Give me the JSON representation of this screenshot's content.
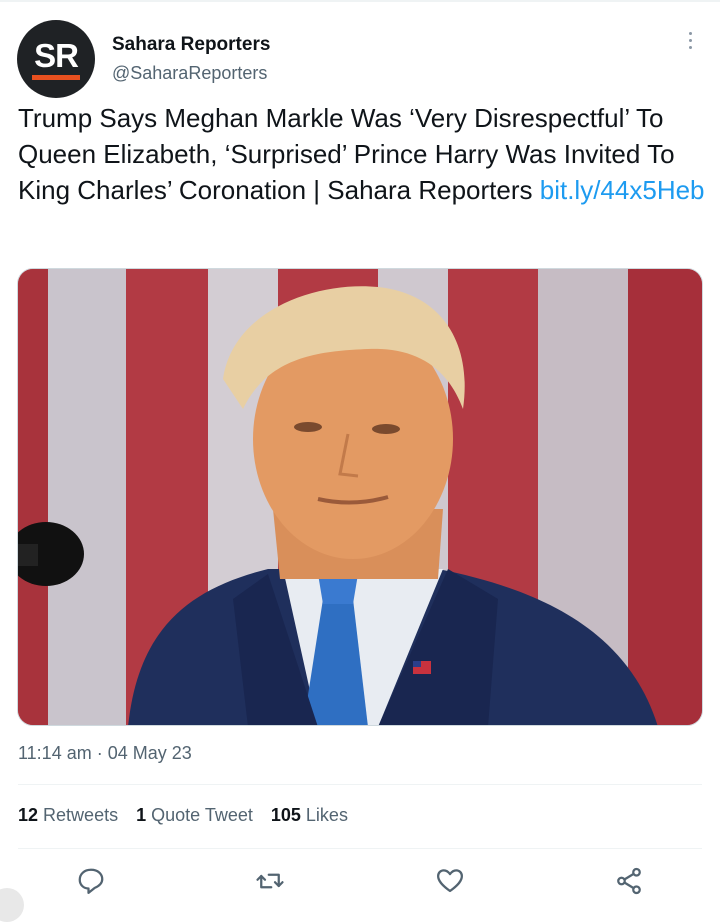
{
  "account": {
    "avatar_text": "SR",
    "name": "Sahara Reporters",
    "handle": "@SaharaReporters"
  },
  "tweet": {
    "text": "Trump Says Meghan Markle Was ‘Very Disrespectful’ To Queen Elizabeth, ‘Surprised’ Prince Harry Was Invited To King Charles’ Coronation | Sahara Reporters",
    "link": "bit.ly/44x5Heb",
    "timestamp": "11:14 am · 04 May 23"
  },
  "stats": {
    "retweets_count": "12",
    "retweets_label": "Retweets",
    "quotes_count": "1",
    "quotes_label": "Quote Tweet",
    "likes_count": "105",
    "likes_label": "Likes"
  },
  "icons": {
    "reply": "reply-icon",
    "retweet": "retweet-icon",
    "like": "heart-icon",
    "share": "share-icon"
  },
  "colors": {
    "link": "#1d9bf0",
    "secondary": "#536471",
    "brand_orange": "#e8501f"
  }
}
